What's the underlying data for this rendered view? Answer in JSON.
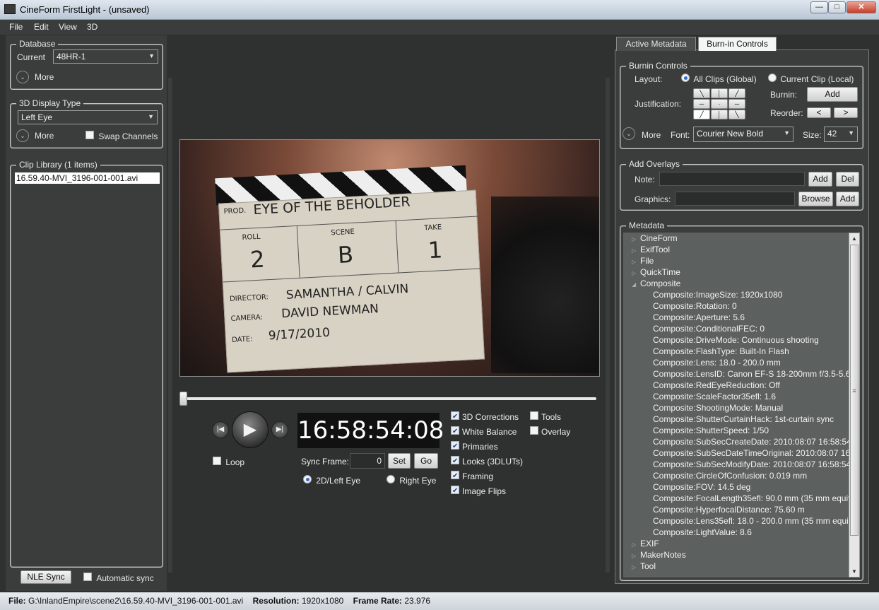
{
  "window": {
    "title": "CineForm FirstLight - (unsaved)",
    "buttons": {
      "minimize": "—",
      "maximize": "□",
      "close": "✕"
    }
  },
  "menu": [
    "File",
    "Edit",
    "View",
    "3D"
  ],
  "database": {
    "title": "Database",
    "current_label": "Current",
    "current_value": "48HR-1",
    "more_label": "More"
  },
  "display3d": {
    "title": "3D Display Type",
    "value": "Left Eye",
    "more_label": "More",
    "swap_label": "Swap Channels"
  },
  "clip_library": {
    "title": "Clip Library (1 items)",
    "items": [
      "16.59.40-MVI_3196-001-001.avi"
    ]
  },
  "nle": {
    "button": "NLE Sync",
    "auto_label": "Automatic sync"
  },
  "slate": {
    "prod_label": "PROD.",
    "prod_value": "EYE OF THE BEHOLDER",
    "roll_label": "ROLL",
    "roll_value": "2",
    "scene_label": "SCENE",
    "scene_value": "B",
    "take_label": "TAKE",
    "take_value": "1",
    "director_label": "DIRECTOR:",
    "director_value": "SAMANTHA / CALVIN",
    "camera_label": "CAMERA:",
    "camera_value": "DAVID NEWMAN",
    "date_label": "DATE:",
    "date_value": "9/17/2010"
  },
  "playback": {
    "seek_fraction": 0.0,
    "timecode": "16:58:54:08",
    "loop_label": "Loop",
    "sync_frame_label": "Sync Frame:",
    "sync_frame_value": "0",
    "set_label": "Set",
    "go_label": "Go",
    "eye_left_label": "2D/Left Eye",
    "eye_right_label": "Right Eye"
  },
  "corrections": [
    {
      "label": "3D Corrections",
      "checked": true
    },
    {
      "label": "White  Balance",
      "checked": true
    },
    {
      "label": "Primaries",
      "checked": true
    },
    {
      "label": "Looks (3DLUTs)",
      "checked": true
    },
    {
      "label": "Framing",
      "checked": true
    },
    {
      "label": "Image Flips",
      "checked": true
    }
  ],
  "tools": [
    {
      "label": "Tools",
      "checked": false
    },
    {
      "label": "Overlay",
      "checked": false
    }
  ],
  "right_tabs": [
    "Active Metadata",
    "Burn-in Controls"
  ],
  "burnin": {
    "title": "Burnin Controls",
    "layout_label": "Layout:",
    "all_clips": "All Clips (Global)",
    "current_clip": "Current Clip (Local)",
    "justification_label": "Justification:",
    "burnin_label": "Burnin:",
    "add_label": "Add",
    "reorder_label": "Reorder:",
    "reorder_left": "<",
    "reorder_right": ">",
    "more_label": "More",
    "font_label": "Font:",
    "font_value": "Courier New Bold",
    "size_label": "Size:",
    "size_value": "42"
  },
  "overlays": {
    "title": "Add Overlays",
    "note_label": "Note:",
    "add_label": "Add",
    "del_label": "Del",
    "graphics_label": "Graphics:",
    "browse_label": "Browse",
    "add2_label": "Add"
  },
  "metadata": {
    "title": "Metadata",
    "top_groups": [
      "CineForm",
      "ExifTool",
      "File",
      "QuickTime",
      "Composite"
    ],
    "composite_items": [
      "Composite:ImageSize: 1920x1080",
      "Composite:Rotation: 0",
      "Composite:Aperture: 5.6",
      "Composite:ConditionalFEC: 0",
      "Composite:DriveMode: Continuous shooting",
      "Composite:FlashType: Built-In Flash",
      "Composite:Lens: 18.0 - 200.0 mm",
      "Composite:LensID: Canon EF-S 18-200mm f/3.5-5.6 I",
      "Composite:RedEyeReduction: Off",
      "Composite:ScaleFactor35efl: 1.6",
      "Composite:ShootingMode: Manual",
      "Composite:ShutterCurtainHack: 1st-curtain sync",
      "Composite:ShutterSpeed: 1/50",
      "Composite:SubSecCreateDate: 2010:08:07 16:58:54.3",
      "Composite:SubSecDateTimeOriginal: 2010:08:07 16:5",
      "Composite:SubSecModifyDate: 2010:08:07 16:58:54.3",
      "Composite:CircleOfConfusion: 0.019 mm",
      "Composite:FOV: 14.5 deg",
      "Composite:FocalLength35efl: 90.0 mm (35 mm equiv",
      "Composite:HyperfocalDistance: 75.60 m",
      "Composite:Lens35efl: 18.0 - 200.0 mm (35 mm equiv",
      "Composite:LightValue: 8.6"
    ],
    "bottom_groups": [
      "EXIF",
      "MakerNotes",
      "Tool"
    ]
  },
  "status": {
    "file_label": "File:",
    "file_value": "G:\\InlandEmpire\\scene2\\16.59.40-MVI_3196-001-001.avi",
    "res_label": "Resolution:",
    "res_value": "1920x1080",
    "fr_label": "Frame Rate:",
    "fr_value": "23.976"
  }
}
